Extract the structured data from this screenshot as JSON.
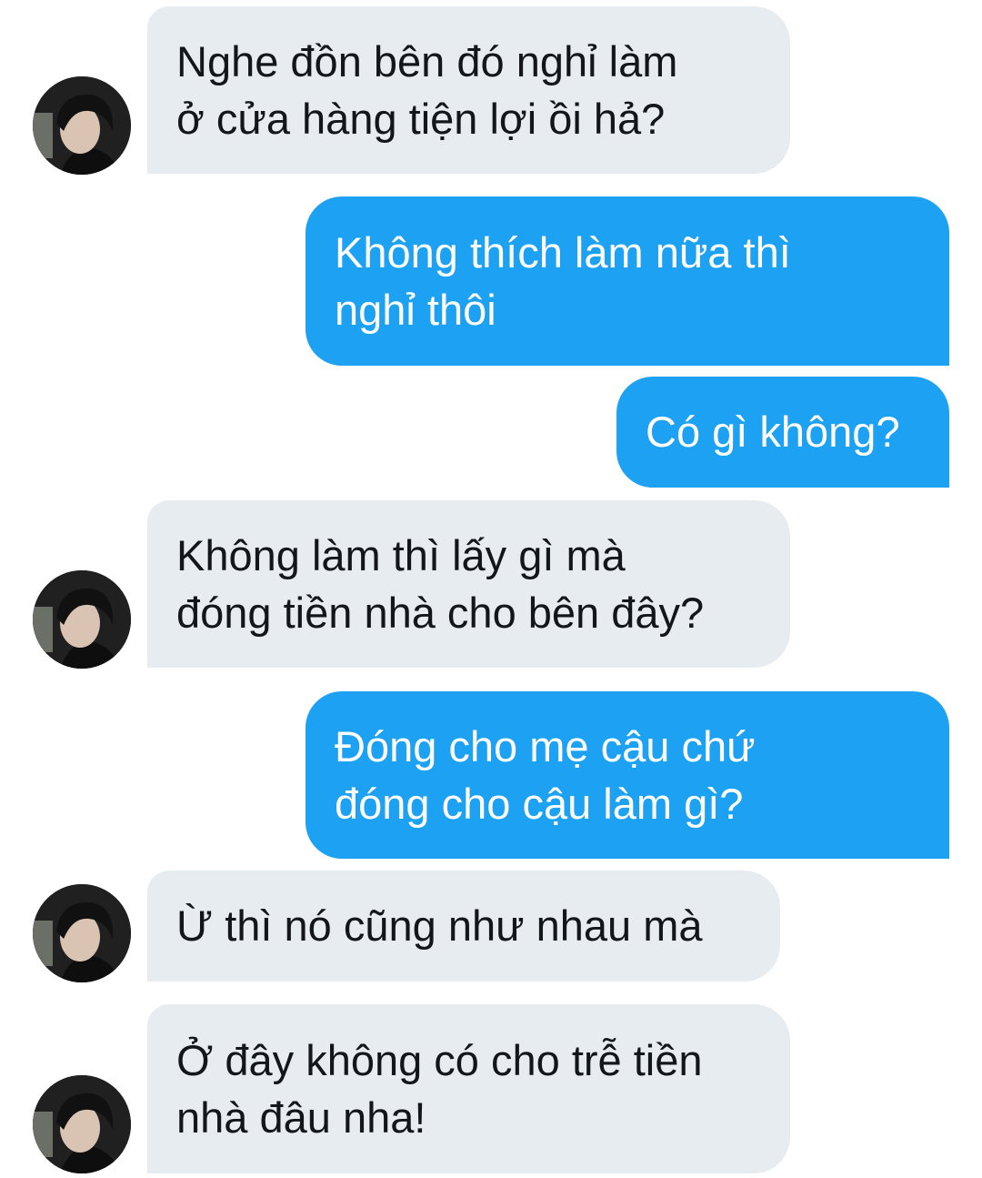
{
  "conversation": {
    "messages": [
      {
        "direction": "incoming",
        "lines": [
          "Nghe đồn bên đó nghỉ làm",
          "ở cửa hàng tiện lợi ồi hả?"
        ]
      },
      {
        "direction": "outgoing",
        "lines": [
          "Không thích làm nữa thì",
          "nghỉ thôi"
        ]
      },
      {
        "direction": "outgoing",
        "lines": [
          "Có gì không?"
        ]
      },
      {
        "direction": "incoming",
        "lines": [
          "Không làm thì lấy gì mà",
          "đóng tiền nhà cho bên đây?"
        ]
      },
      {
        "direction": "outgoing",
        "lines": [
          "Đóng cho mẹ cậu chứ",
          "đóng cho cậu làm gì?"
        ]
      },
      {
        "direction": "incoming",
        "lines": [
          "Ừ thì nó cũng như nhau mà"
        ]
      },
      {
        "direction": "incoming",
        "lines": [
          "Ở đây không có cho trễ tiền",
          "nhà đâu nha!"
        ]
      }
    ]
  },
  "colors": {
    "incoming_bubble": "#e6ecf0",
    "incoming_text": "#14171a",
    "outgoing_bubble": "#1da1f2",
    "outgoing_text": "#ffffff"
  },
  "icons": {
    "contact_avatar": "contact-avatar-photo"
  }
}
